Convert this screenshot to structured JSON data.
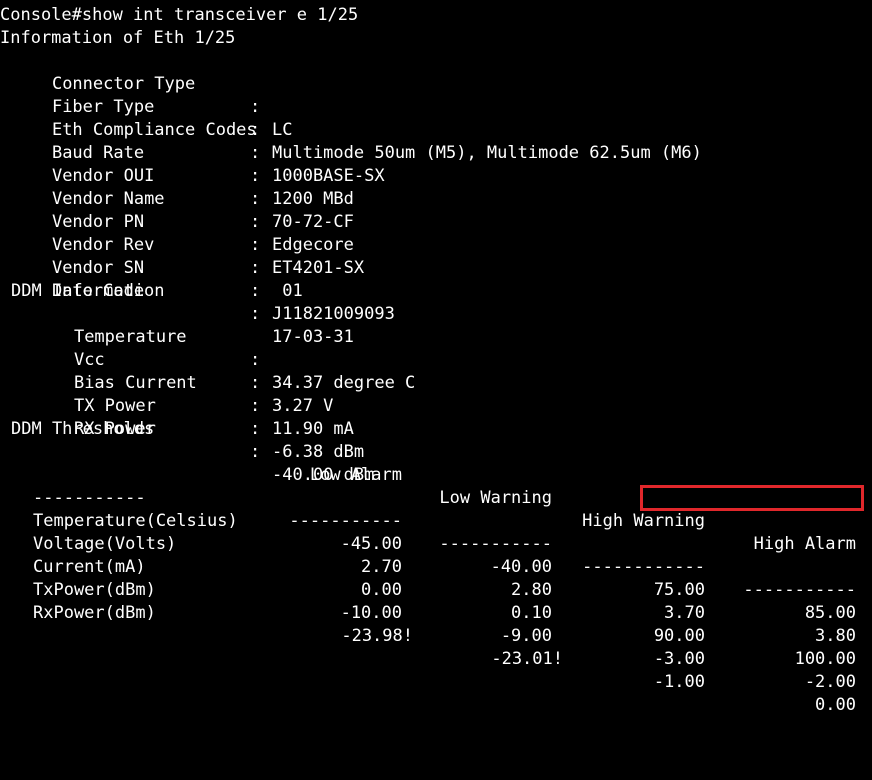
{
  "prompt": "Console#show int transceiver e 1/25",
  "info_header": "Information of Eth 1/25",
  "sep": ":",
  "fields": [
    {
      "label": "Connector Type",
      "value": "LC"
    },
    {
      "label": "Fiber Type",
      "value": "Multimode 50um (M5), Multimode 62.5um (M6)"
    },
    {
      "label": "Eth Compliance Codes",
      "value": "1000BASE-SX"
    },
    {
      "label": "Baud Rate",
      "value": "1200 MBd"
    },
    {
      "label": "Vendor OUI",
      "value": "70-72-CF"
    },
    {
      "label": "Vendor Name",
      "value": "Edgecore"
    },
    {
      "label": "Vendor PN",
      "value": "ET4201-SX"
    },
    {
      "label": "Vendor Rev",
      "value": " 01"
    },
    {
      "label": "Vendor SN",
      "value": "J11821009093"
    },
    {
      "label": "Date Code",
      "value": "17-03-31"
    }
  ],
  "ddm_info": {
    "title": "DDM Information",
    "items": [
      {
        "label": "Temperature",
        "value": "34.37 degree C"
      },
      {
        "label": "Vcc",
        "value": "3.27 V"
      },
      {
        "label": "Bias Current",
        "value": "11.90 mA"
      },
      {
        "label": "TX Power",
        "value": "-6.38 dBm"
      },
      {
        "label": "RX Power",
        "value": "-40.00 dBm"
      }
    ]
  },
  "ddm_thresholds": {
    "title": "DDM Thresholds",
    "columns": [
      "Low Alarm",
      "Low Warning",
      "High Warning",
      "High Alarm"
    ],
    "underline_label": "-----------",
    "underline_cols": [
      "-----------",
      "-----------",
      "------------",
      "-----------"
    ],
    "rows": [
      {
        "label": "Temperature(Celsius)",
        "values": [
          "-45.00",
          "-40.00",
          "75.00",
          "85.00"
        ]
      },
      {
        "label": "Voltage(Volts)",
        "values": [
          "2.70",
          "2.80",
          "3.70",
          "3.80"
        ]
      },
      {
        "label": "Current(mA)",
        "values": [
          "0.00",
          "0.10",
          "90.00",
          "100.00"
        ]
      },
      {
        "label": "TxPower(dBm)",
        "values": [
          "-10.00",
          "-9.00",
          "-3.00",
          "-2.00"
        ]
      },
      {
        "label": "RxPower(dBm)",
        "values": [
          "-23.98!",
          "-23.01!",
          "-1.00",
          "0.00"
        ]
      }
    ]
  },
  "colors": {
    "background": "#000000",
    "text": "#ffffff",
    "highlight": "#e0272b"
  }
}
